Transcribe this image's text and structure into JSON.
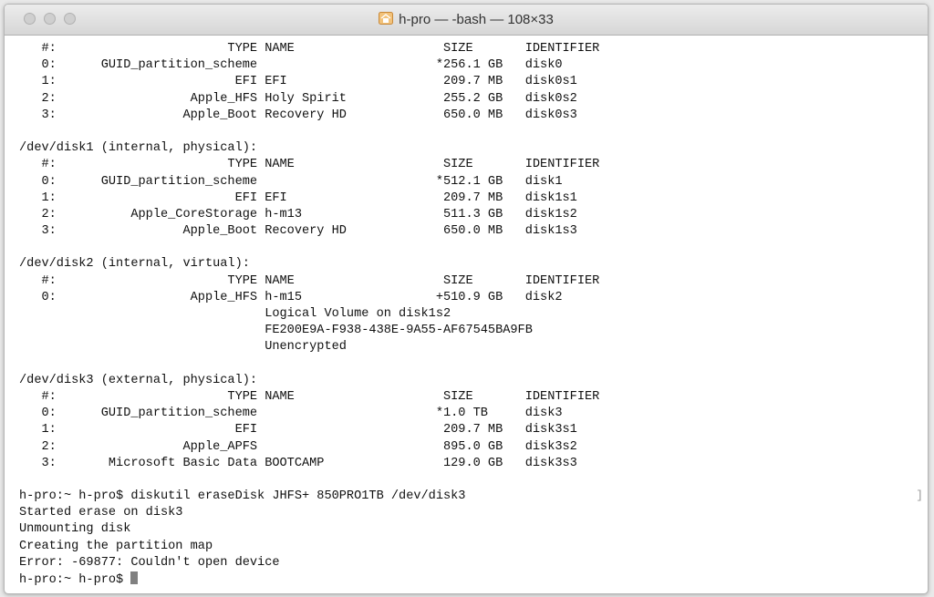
{
  "window": {
    "title": "h-pro — -bash — 108×33",
    "title_icon": "home-icon",
    "traffic_light_color": "#cfcfcf"
  },
  "terminal": {
    "lines": [
      "   #:                       TYPE NAME                    SIZE       IDENTIFIER",
      "   0:      GUID_partition_scheme                        *256.1 GB   disk0",
      "   1:                        EFI EFI                     209.7 MB   disk0s1",
      "   2:                  Apple_HFS Holy Spirit             255.2 GB   disk0s2",
      "   3:                 Apple_Boot Recovery HD             650.0 MB   disk0s3",
      "",
      "/dev/disk1 (internal, physical):",
      "   #:                       TYPE NAME                    SIZE       IDENTIFIER",
      "   0:      GUID_partition_scheme                        *512.1 GB   disk1",
      "   1:                        EFI EFI                     209.7 MB   disk1s1",
      "   2:          Apple_CoreStorage h-m13                   511.3 GB   disk1s2",
      "   3:                 Apple_Boot Recovery HD             650.0 MB   disk1s3",
      "",
      "/dev/disk2 (internal, virtual):",
      "   #:                       TYPE NAME                    SIZE       IDENTIFIER",
      "   0:                  Apple_HFS h-m15                  +510.9 GB   disk2",
      "                                 Logical Volume on disk1s2",
      "                                 FE200E9A-F938-438E-9A55-AF67545BA9FB",
      "                                 Unencrypted",
      "",
      "/dev/disk3 (external, physical):",
      "   #:                       TYPE NAME                    SIZE       IDENTIFIER",
      "   0:      GUID_partition_scheme                        *1.0 TB     disk3",
      "   1:                        EFI                         209.7 MB   disk3s1",
      "   2:                 Apple_APFS                         895.0 GB   disk3s2",
      "   3:       Microsoft Basic Data BOOTCAMP                129.0 GB   disk3s3",
      "",
      "h-pro:~ h-pro$ diskutil eraseDisk JHFS+ 850PRO1TB /dev/disk3",
      "Started erase on disk3",
      "Unmounting disk",
      "Creating the partition map",
      "Error: -69877: Couldn't open device"
    ],
    "prompt": "h-pro:~ h-pro$ ",
    "right_marker": "]"
  }
}
